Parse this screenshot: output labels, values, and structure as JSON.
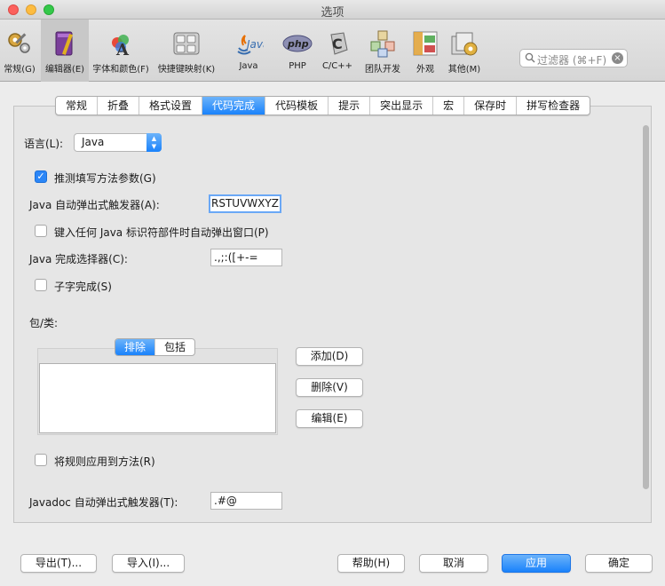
{
  "window": {
    "title": "选项"
  },
  "toolbar": {
    "items": [
      {
        "label": "常规(G)",
        "icon": "gears-icon"
      },
      {
        "label": "编辑器(E)",
        "icon": "editor-icon"
      },
      {
        "label": "字体和颜色(F)",
        "icon": "fonts-colors-icon"
      },
      {
        "label": "快捷键映射(K)",
        "icon": "keyboard-icon"
      },
      {
        "label": "Java",
        "icon": "java-icon"
      },
      {
        "label": "PHP",
        "icon": "php-icon"
      },
      {
        "label": "C/C++",
        "icon": "cpp-icon"
      },
      {
        "label": "团队开发",
        "icon": "team-icon"
      },
      {
        "label": "外观",
        "icon": "appearance-icon"
      },
      {
        "label": "其他(M)",
        "icon": "misc-icon"
      }
    ],
    "active": "编辑器(E)",
    "search_placeholder": "过滤器 (⌘+F)"
  },
  "tabs": {
    "items": [
      "常规",
      "折叠",
      "格式设置",
      "代码完成",
      "代码模板",
      "提示",
      "突出显示",
      "宏",
      "保存时",
      "拼写检查器"
    ],
    "active": "代码完成"
  },
  "form": {
    "language_label": "语言(L):",
    "language_value": "Java",
    "guess_params_label": "推测填写方法参数(G)",
    "guess_params_checked": true,
    "auto_popup_label": "Java 自动弹出式触发器(A):",
    "auto_popup_value": "RSTUVWXYZ",
    "popup_on_identifier_label": "键入任何 Java 标识符部件时自动弹出窗口(P)",
    "popup_on_identifier_checked": false,
    "selectors_label": "Java 完成选择器(C):",
    "selectors_value": ".,;:([+-=",
    "subword_label": "子字完成(S)",
    "subword_checked": false,
    "packages_label": "包/类:",
    "segment": {
      "exclude": "排除",
      "include": "包括",
      "active": "排除"
    },
    "add_button": "添加(D)",
    "remove_button": "删除(V)",
    "edit_button": "编辑(E)",
    "apply_rules_label": "将规则应用到方法(R)",
    "apply_rules_checked": false,
    "javadoc_label": "Javadoc 自动弹出式触发器(T):",
    "javadoc_value": ".#@"
  },
  "footer": {
    "export": "导出(T)...",
    "import": "导入(I)...",
    "help": "帮助(H)",
    "cancel": "取消",
    "apply": "应用",
    "ok": "确定"
  },
  "colors": {
    "accent": "#1a82fb",
    "accent_light": "#6cb3fa",
    "window_bg": "#ececec"
  }
}
